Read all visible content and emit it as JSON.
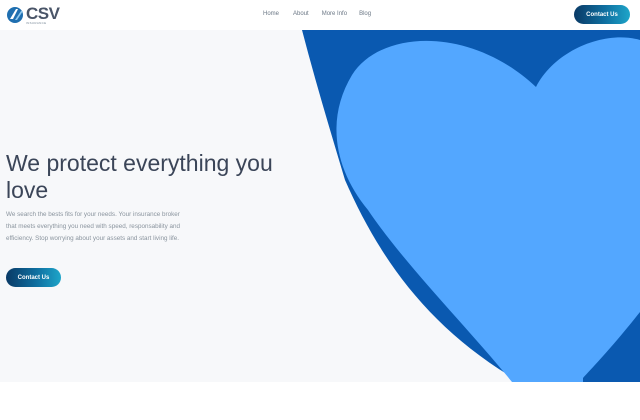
{
  "brand": {
    "name": "CSV",
    "tagline": "INSURANCE"
  },
  "nav": {
    "items": [
      "Home",
      "About",
      "More Info",
      "Blog"
    ]
  },
  "header": {
    "cta_label": "Contact Us"
  },
  "hero": {
    "title": "We protect everything you love",
    "description": "We search the bests fits for your needs. Your insurance broker that meets everything you need with speed, responsability and efficiency. Stop worrying about your assets and start living life.",
    "cta_label": "Contact Us"
  },
  "colors": {
    "brand_dark": "#0a3a66",
    "brand_gradient_end": "#1ea5c9",
    "heart_dark": "#0a59b0",
    "heart_light": "#53a7ff",
    "hero_bg": "#f7f8fa",
    "title_text": "#3b4558"
  },
  "icons": [
    "logo-mark-icon"
  ]
}
